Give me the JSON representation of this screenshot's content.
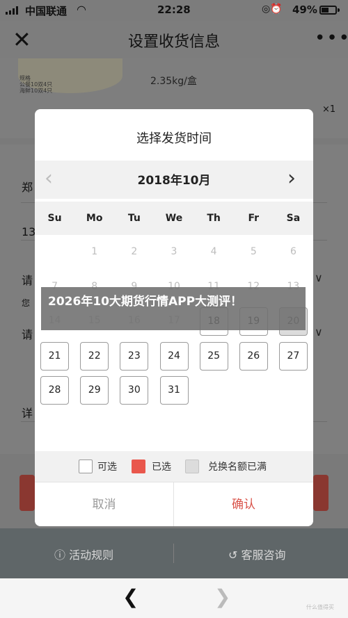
{
  "status_bar": {
    "carrier": "中国联通",
    "time": "22:28",
    "battery": "49%"
  },
  "header": {
    "close_icon": "close-icon",
    "title": "设置收货信息",
    "more_icon": "more-icon"
  },
  "product": {
    "thumb_label": "规格\n公餐10双4只\n海鲜10双4只",
    "spec": "2.35kg/盒",
    "quantity": "×1"
  },
  "form_hints": [
    "郑",
    "13",
    "请",
    "您",
    "请",
    "详"
  ],
  "bottom_tabs": {
    "rules": "活动规则",
    "service": "客服咨询"
  },
  "modal": {
    "title": "选择发货时间",
    "month": "2018年10月",
    "weekdays": [
      "Su",
      "Mo",
      "Tu",
      "We",
      "Th",
      "Fr",
      "Sa"
    ],
    "days": [
      {
        "day": "1",
        "state": "past"
      },
      {
        "day": "2",
        "state": "past"
      },
      {
        "day": "3",
        "state": "past"
      },
      {
        "day": "4",
        "state": "past"
      },
      {
        "day": "5",
        "state": "past"
      },
      {
        "day": "6",
        "state": "past"
      },
      {
        "day": "7",
        "state": "past"
      },
      {
        "day": "8",
        "state": "past"
      },
      {
        "day": "9",
        "state": "past"
      },
      {
        "day": "10",
        "state": "past"
      },
      {
        "day": "11",
        "state": "past"
      },
      {
        "day": "12",
        "state": "past"
      },
      {
        "day": "13",
        "state": "past"
      },
      {
        "day": "14",
        "state": "past"
      },
      {
        "day": "15",
        "state": "past"
      },
      {
        "day": "16",
        "state": "past"
      },
      {
        "day": "17",
        "state": "past"
      },
      {
        "day": "18",
        "state": "available"
      },
      {
        "day": "19",
        "state": "available"
      },
      {
        "day": "20",
        "state": "full"
      },
      {
        "day": "21",
        "state": "available"
      },
      {
        "day": "22",
        "state": "available"
      },
      {
        "day": "23",
        "state": "available"
      },
      {
        "day": "24",
        "state": "available"
      },
      {
        "day": "25",
        "state": "available"
      },
      {
        "day": "26",
        "state": "available"
      },
      {
        "day": "27",
        "state": "available"
      },
      {
        "day": "28",
        "state": "available"
      },
      {
        "day": "29",
        "state": "available"
      },
      {
        "day": "30",
        "state": "available"
      },
      {
        "day": "31",
        "state": "available"
      }
    ],
    "first_weekday_index": 1,
    "legend": {
      "available": "可选",
      "selected": "已选",
      "full": "兑换名额已满"
    },
    "colors": {
      "selected": "#e9574c",
      "full": "#dcdcdc",
      "confirm": "#d9534a"
    },
    "cancel": "取消",
    "confirm": "确认"
  },
  "banner": {
    "text": "2026年10大期货行情APP大测评！"
  },
  "watermark": "什么值得买"
}
